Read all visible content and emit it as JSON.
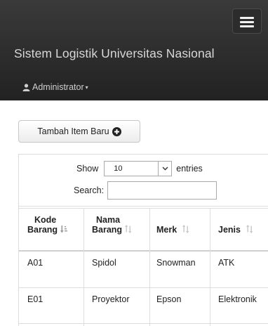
{
  "navbar": {
    "brand": "Sistem Logistik Universitas Nasional",
    "user": "Administrator"
  },
  "actions": {
    "add_item_label": "Tambah Item Baru"
  },
  "datatable": {
    "show_label": "Show",
    "entries_value": "10",
    "entries_label": "entries",
    "search_label": "Search:",
    "search_value": "",
    "columns": [
      {
        "line1": "Kode",
        "line2": "Barang"
      },
      {
        "line1": "Nama",
        "line2": "Barang"
      },
      {
        "line1": "",
        "line2": "Merk"
      },
      {
        "line1": "",
        "line2": "Jenis"
      }
    ],
    "rows": [
      [
        "A01",
        "Spidol",
        "Snowman",
        "ATK"
      ],
      [
        "E01",
        "Proyektor",
        "Epson",
        "Elektronik"
      ]
    ]
  },
  "icons": {
    "menu": "hamburger-icon",
    "user": "user-icon",
    "add": "plus-circle-icon",
    "sort_active": "sort-ascending-icon",
    "sort_inactive": "sort-both-icon"
  }
}
